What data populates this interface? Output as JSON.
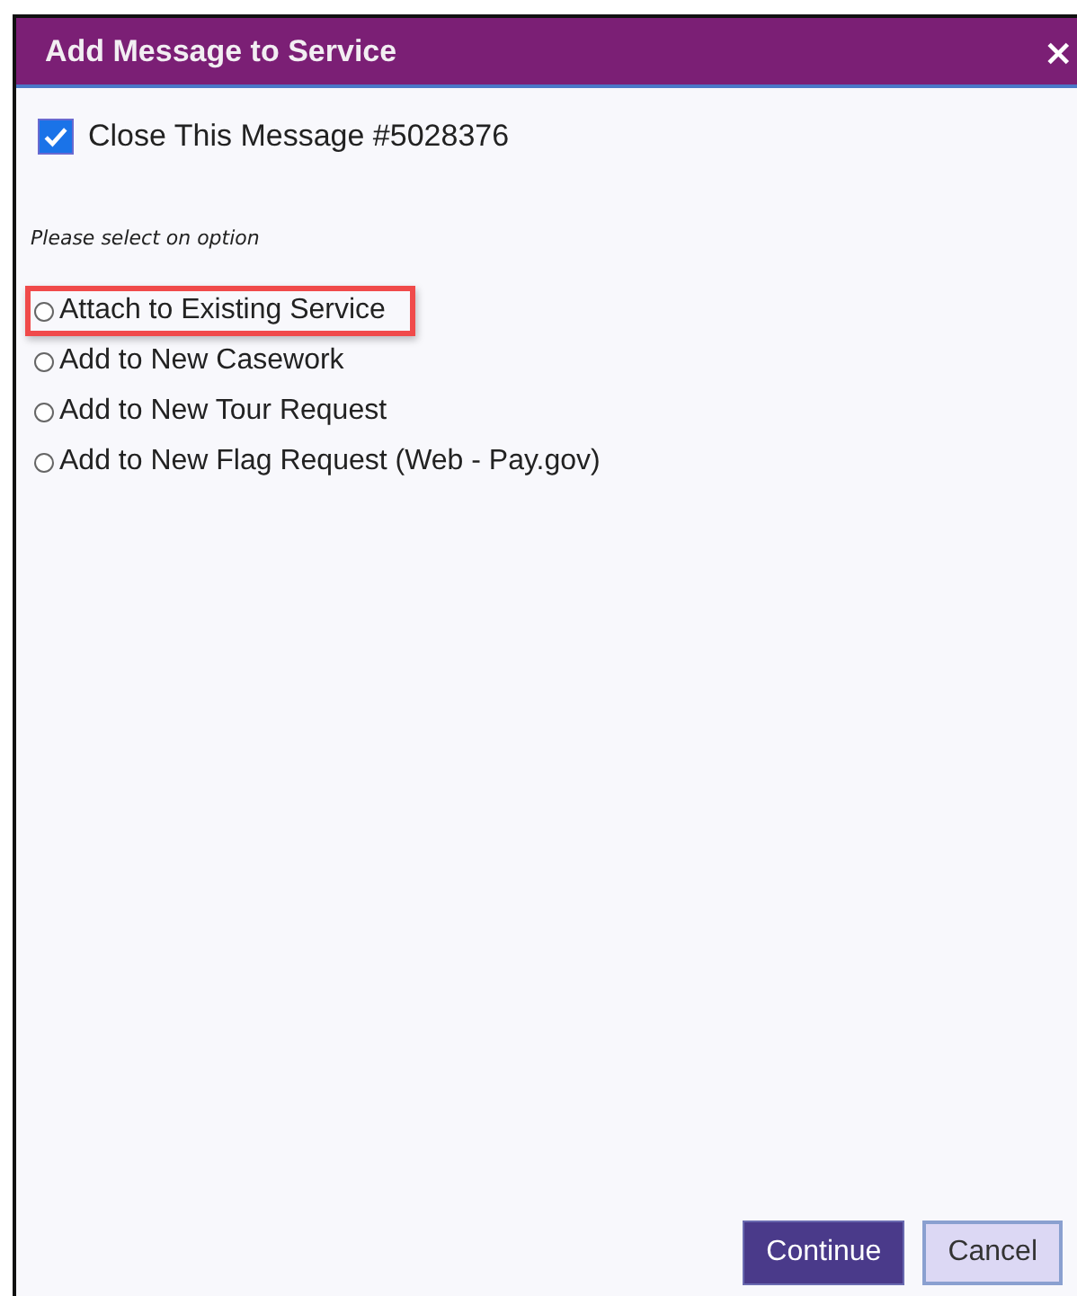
{
  "dialog": {
    "title": "Add Message to Service",
    "close": "×"
  },
  "close_message": {
    "label": "Close This Message #5028376",
    "checked": true
  },
  "prompt": "Please select on option",
  "options": [
    {
      "label": "Attach to Existing Service",
      "selected": false,
      "highlighted": true
    },
    {
      "label": "Add to New Casework",
      "selected": false,
      "highlighted": false
    },
    {
      "label": "Add to New Tour Request",
      "selected": false,
      "highlighted": false
    },
    {
      "label": "Add to New Flag Request (Web - Pay.gov)",
      "selected": false,
      "highlighted": false
    }
  ],
  "buttons": [
    {
      "label": "Continue",
      "kind": "primary"
    },
    {
      "label": "Cancel",
      "kind": "secondary"
    }
  ]
}
